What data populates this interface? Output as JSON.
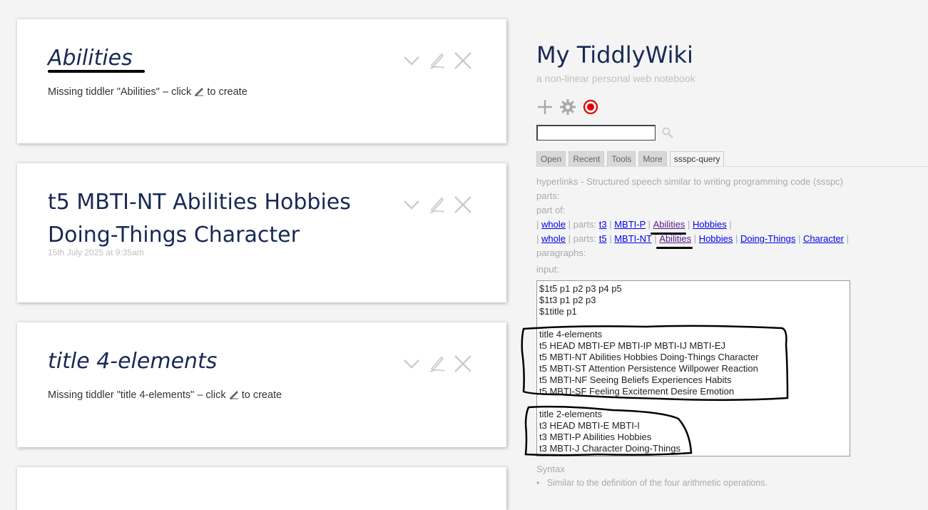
{
  "story": {
    "tiddlers": [
      {
        "title": "Abilities",
        "missing": true,
        "body_prefix": "Missing tiddler \"Abilities\" – click",
        "body_suffix": "to create"
      },
      {
        "title": "t5 MBTI-NT Abilities Hobbies Doing-Things Character",
        "missing": false,
        "subtitle": "15th July 2025 at 9:35am"
      },
      {
        "title": "title 4-elements",
        "missing": true,
        "body_prefix": "Missing tiddler \"title 4-elements\" – click",
        "body_suffix": "to create"
      }
    ],
    "control_icons": [
      "chevron-down-icon",
      "edit-pencil-icon",
      "close-icon"
    ]
  },
  "sidebar": {
    "site_title": "My TiddlyWiki",
    "site_subtitle": "a non-linear personal web notebook",
    "page_controls": [
      "new-tiddler-icon",
      "control-panel-gear-icon",
      "record-icon"
    ],
    "search": {
      "value": "",
      "placeholder": ""
    },
    "tabs": [
      "Open",
      "Recent",
      "Tools",
      "More",
      "ssspc-query"
    ],
    "active_tab": "ssspc-query",
    "tab_content": {
      "heading": "hyperlinks - Structured speech similar to writing programming code (ssspc)",
      "parts_label": "parts:",
      "part_of_label": "part of:",
      "row1": {
        "whole": "whole",
        "parts_label": "parts:",
        "links": [
          "t3",
          "MBTI-P",
          "Abilities",
          "Hobbies"
        ]
      },
      "row2": {
        "whole": "whole",
        "parts_label": "parts:",
        "links": [
          "t5",
          "MBTI-NT",
          "Abilities",
          "Hobbies",
          "Doing-Things",
          "Character"
        ]
      },
      "paragraphs_label": "paragraphs:",
      "input_label": "input:",
      "input_value": "$1t5 p1 p2 p3 p4 p5\n$1t3 p1 p2 p3\n$1title p1\n\ntitle 4-elements\nt5 HEAD MBTI-EP MBTI-IP MBTI-IJ MBTI-EJ\nt5 MBTI-NT Abilities Hobbies Doing-Things Character\nt5 MBTI-ST Attention Persistence Willpower Reaction\nt5 MBTI-NF Seeing Beliefs Experiences Habits\nt5 MBTI-SF Feeling Excitement Desire Emotion\n\ntitle 2-elements\nt3 HEAD MBTI-E MBTI-I\nt3 MBTI-P Abilities Hobbies\nt3 MBTI-J Character Doing-Things",
      "syntax_label": "Syntax",
      "syntax_bullet": "Similar to the definition of the four arithmetic operations."
    }
  },
  "colors": {
    "title": "#182955",
    "link": "#0000ee",
    "visited_link": "#551a8b",
    "record_red": "#e00000"
  }
}
